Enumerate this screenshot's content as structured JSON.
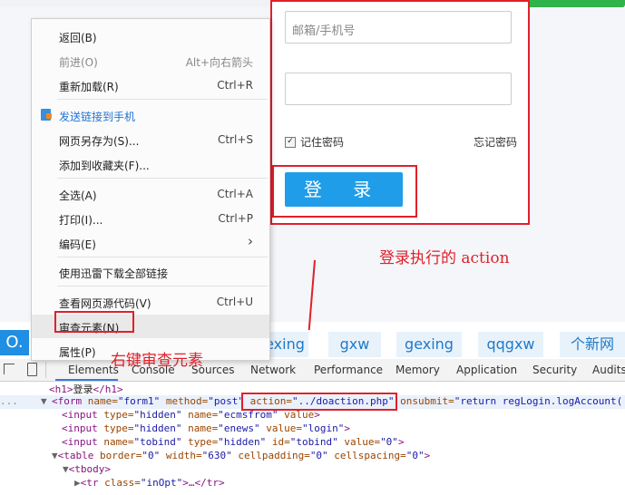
{
  "login": {
    "email_placeholder": "邮箱/手机号",
    "password_placeholder": "",
    "remember_label": "记住密码",
    "remember_checked": true,
    "forgot_label": "忘记密码",
    "login_button": "登 录"
  },
  "annotations": {
    "action_note": "登录执行的 action",
    "inspect_note": "右键审查元素"
  },
  "context_menu": {
    "back": {
      "label": "返回(B)"
    },
    "forward": {
      "label": "前进(O)",
      "shortcut": "Alt+向右箭头"
    },
    "reload": {
      "label": "重新加载(R)",
      "shortcut": "Ctrl+R"
    },
    "send_to_phone": {
      "label": "发送链接到手机"
    },
    "save_as": {
      "label": "网页另存为(S)...",
      "shortcut": "Ctrl+S"
    },
    "add_favorite": {
      "label": "添加到收藏夹(F)..."
    },
    "select_all": {
      "label": "全选(A)",
      "shortcut": "Ctrl+A"
    },
    "print": {
      "label": "打印(I)...",
      "shortcut": "Ctrl+P"
    },
    "encoding": {
      "label": "编码(E)",
      "arrow": "›"
    },
    "xunlei": {
      "label": "使用迅雷下载全部链接"
    },
    "view_source": {
      "label": "查看网页源代码(V)",
      "shortcut": "Ctrl+U"
    },
    "inspect": {
      "label": "审查元素(N)"
    },
    "properties": {
      "label": "属性(P)"
    }
  },
  "tags": {
    "logo": "O.",
    "items": [
      "exing",
      "gxw",
      "gexing",
      "qqgxw",
      "个新网"
    ]
  },
  "devtools": {
    "tabs": [
      "Elements",
      "Console",
      "Sources",
      "Network",
      "Performance",
      "Memory",
      "Application",
      "Security",
      "Audits"
    ],
    "active_tab": "Elements",
    "lines": {
      "l1": {
        "open": "<h1>",
        "text": "登录",
        "close": "</h1>"
      },
      "l2": {
        "marker": "...",
        "tri": "▼",
        "tag": "<form",
        "a1": " name=",
        "v1": "\"form1\"",
        "a2": " method=",
        "v2": "\"post\"",
        "a3": " action=",
        "v3": "\"../doaction.php\"",
        "a4": " onsubmit=",
        "v4": "\"return regLogin.logAccount('"
      },
      "l3": {
        "tag": "<input",
        "a1": " type=",
        "v1": "\"hidden\"",
        "a2": " name=",
        "v2": "\"ecmsfrom\"",
        "a3": " value",
        "end": ">"
      },
      "l4": {
        "tag": "<input",
        "a1": " type=",
        "v1": "\"hidden\"",
        "a2": " name=",
        "v2": "\"enews\"",
        "a3": " value=",
        "v3": "\"login\"",
        "end": ">"
      },
      "l5": {
        "tag": "<input",
        "a1": " name=",
        "v1": "\"tobind\"",
        "a2": " type=",
        "v2": "\"hidden\"",
        "a3": " id=",
        "v3": "\"tobind\"",
        "a4": " value=",
        "v4": "\"0\"",
        "end": ">"
      },
      "l6": {
        "tri": "▼",
        "tag": "<table",
        "a1": " border=",
        "v1": "\"0\"",
        "a2": " width=",
        "v2": "\"630\"",
        "a3": " cellpadding=",
        "v3": "\"0\"",
        "a4": " cellspacing=",
        "v4": "\"0\"",
        "end": ">"
      },
      "l7": {
        "tri": "▼",
        "tag": "<tbody>"
      },
      "l8": {
        "tri": "▶",
        "tag": "<tr",
        "a1": " class=",
        "v1": "\"inOpt\"",
        "end": ">…</tr>"
      }
    }
  },
  "colors": {
    "annotation_red": "#e0202a",
    "login_blue": "#1f9de8",
    "devtools_tab_underline": "#3879d9"
  }
}
